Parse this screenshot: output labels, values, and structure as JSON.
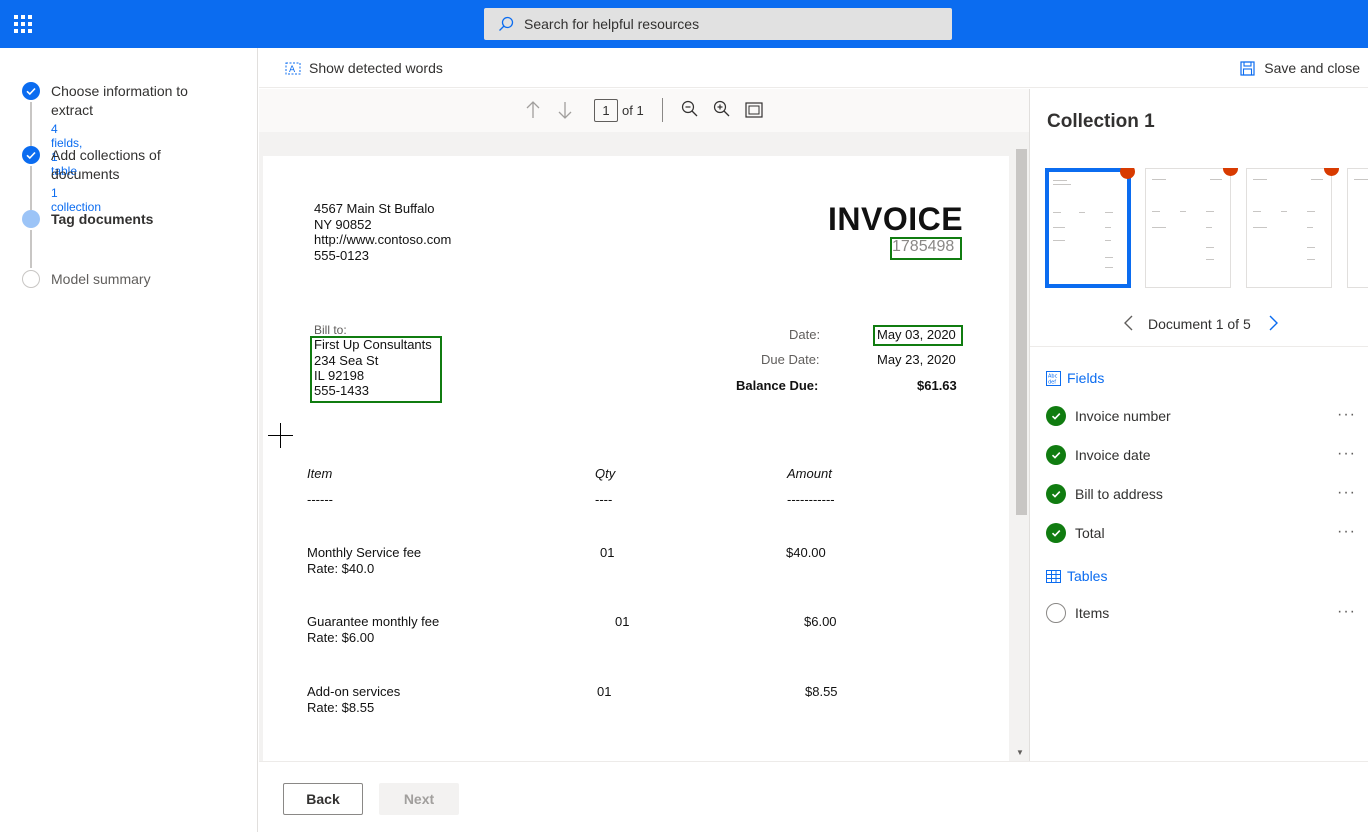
{
  "search": {
    "placeholder": "Search for helpful resources"
  },
  "steps": [
    {
      "title": "Choose information to extract",
      "sub": "4 fields, 1 table"
    },
    {
      "title": "Add collections of documents",
      "sub": "1 collection"
    },
    {
      "title": "Tag documents"
    },
    {
      "title": "Model summary"
    }
  ],
  "toolbar": {
    "show_words": "Show detected words",
    "save_close": "Save and close"
  },
  "viewer": {
    "page_current": "1",
    "page_of": "of 1"
  },
  "invoice": {
    "addr1": "4567 Main St Buffalo",
    "addr2": "NY 90852",
    "addr3": "http://www.contoso.com",
    "addr4": "555-0123",
    "title": "INVOICE",
    "number": "1785498",
    "bill_to_label": "Bill to:",
    "bill1": "First Up Consultants",
    "bill2": "234 Sea St",
    "bill3": "IL 92198",
    "bill4": "555-1433",
    "date_label": "Date:",
    "date": "May 03, 2020",
    "due_label": "Due Date:",
    "due": "May 23, 2020",
    "balance_label": "Balance Due:",
    "balance": "$61.63",
    "col_item": "Item",
    "col_qty": "Qty",
    "col_amount": "Amount",
    "rule_item": "------",
    "rule_qty": "----",
    "rule_amount": "-----------",
    "rows": [
      {
        "name": "Monthly Service fee",
        "rate": "Rate: $40.0",
        "qty": "01",
        "amount": "$40.00"
      },
      {
        "name": "Guarantee monthly fee",
        "rate": "Rate: $6.00",
        "qty": "01",
        "amount": "$6.00"
      },
      {
        "name": "Add-on services",
        "rate": "Rate: $8.55",
        "qty": "01",
        "amount": "$8.55"
      }
    ]
  },
  "footer": {
    "back": "Back",
    "next": "Next"
  },
  "panel": {
    "title": "Collection 1",
    "doc_nav": "Document 1 of 5",
    "fields_label": "Fields",
    "fields": [
      "Invoice number",
      "Invoice date",
      "Bill to address",
      "Total"
    ],
    "tables_label": "Tables",
    "tables": [
      "Items"
    ],
    "more": "···"
  },
  "colors": {
    "brand": "#0b6cf0",
    "tag": "#107c10",
    "badge": "#d83b01"
  }
}
